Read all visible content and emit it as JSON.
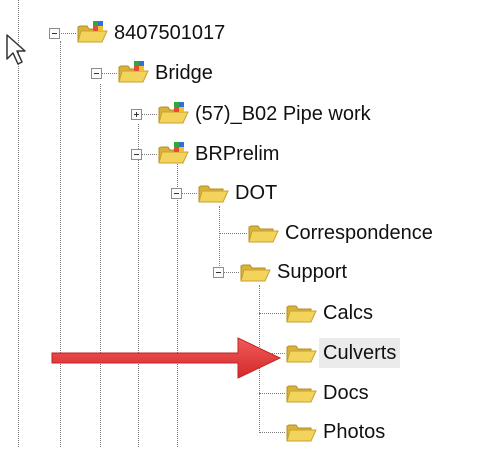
{
  "tree": {
    "nodes": [
      {
        "label": "8407501017",
        "icon": "project-folder-icon",
        "state": "expanded"
      },
      {
        "label": "Bridge",
        "icon": "project-folder-icon",
        "state": "expanded"
      },
      {
        "label": "(57)_B02 Pipe work",
        "icon": "project-folder-icon",
        "state": "collapsed"
      },
      {
        "label": "BRPrelim",
        "icon": "project-folder-icon",
        "state": "expanded"
      },
      {
        "label": "DOT",
        "icon": "folder-icon",
        "state": "expanded"
      },
      {
        "label": "Correspondence",
        "icon": "folder-icon",
        "state": "leaf"
      },
      {
        "label": "Support",
        "icon": "folder-icon",
        "state": "expanded"
      },
      {
        "label": "Calcs",
        "icon": "folder-icon",
        "state": "leaf"
      },
      {
        "label": "Culverts",
        "icon": "folder-icon",
        "state": "leaf",
        "selected": true
      },
      {
        "label": "Docs",
        "icon": "folder-icon",
        "state": "leaf"
      },
      {
        "label": "Photos",
        "icon": "folder-icon",
        "state": "leaf"
      }
    ]
  },
  "colors": {
    "folder": "#e8c64a",
    "folder_dark": "#c9a22c",
    "arrow": "#e03c3c",
    "selection": "#ebebeb"
  },
  "overlay": {
    "pointer": "mouse-pointer-icon",
    "annotation": "red-arrow-pointing-to-culverts"
  }
}
